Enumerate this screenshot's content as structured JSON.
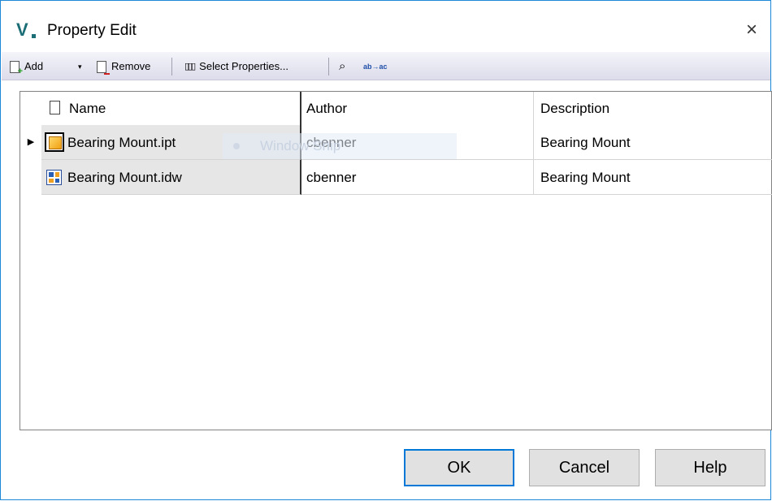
{
  "window": {
    "title": "Property Edit",
    "logo_letter": "V",
    "close_glyph": "×"
  },
  "toolbar": {
    "add_label": "Add",
    "add_dropdown_glyph": "▾",
    "remove_label": "Remove",
    "select_properties_label": "Select Properties...",
    "select_properties_glyph": "▯▯▯",
    "find_glyph": "⌕",
    "replace_glyph": "ab→ac"
  },
  "grid": {
    "columns": [
      "Name",
      "Author",
      "Description"
    ],
    "rows": [
      {
        "indicator": "▶",
        "icon": "part-icon",
        "name": "Bearing Mount.ipt",
        "author": "cbenner",
        "description": "Bearing Mount"
      },
      {
        "indicator": "",
        "icon": "drawing-icon",
        "name": "Bearing Mount.idw",
        "author": "cbenner",
        "description": "Bearing Mount"
      }
    ]
  },
  "ghost_overlay": {
    "text": "Window Snip"
  },
  "buttons": {
    "ok": "OK",
    "cancel": "Cancel",
    "help": "Help"
  },
  "colors": {
    "accent": "#0078d7",
    "window_border": "#1e88d8",
    "logo": "#1b6e75"
  }
}
